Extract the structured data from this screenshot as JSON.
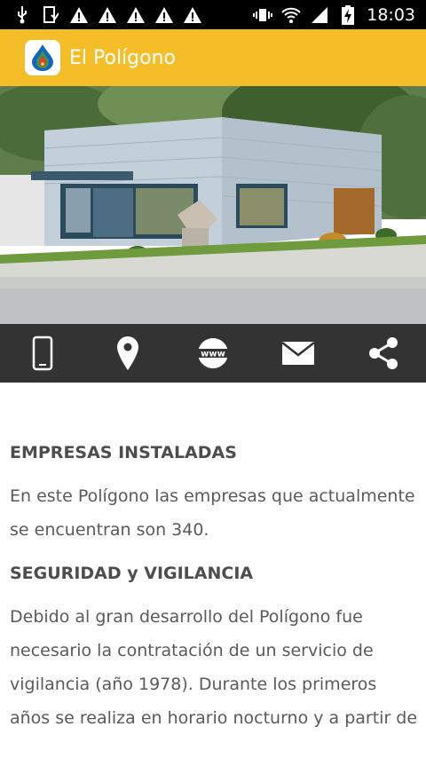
{
  "statusbar": {
    "time": "18:03"
  },
  "appbar": {
    "title": "El Polígono"
  },
  "actions": [
    "phone-icon",
    "location-icon",
    "www-icon",
    "mail-icon",
    "share-icon"
  ],
  "actions_labels": {
    "www": "www"
  },
  "content": {
    "heading1": "EMPRESAS INSTALADAS",
    "para1": "En este Polígono las empresas que actualmente se encuentran son 340.",
    "heading2": "SEGURIDAD y VIGILANCIA",
    "para2": "Debido al gran desarrollo del Polígono fue necesario la contratación de un servicio de vigilancia (año 1978). Durante los primeros años se realiza en horario nocturno y a partir de"
  },
  "colors": {
    "appbar": "#f5bd28",
    "actionbar": "#333333",
    "statusbar": "#000000"
  }
}
